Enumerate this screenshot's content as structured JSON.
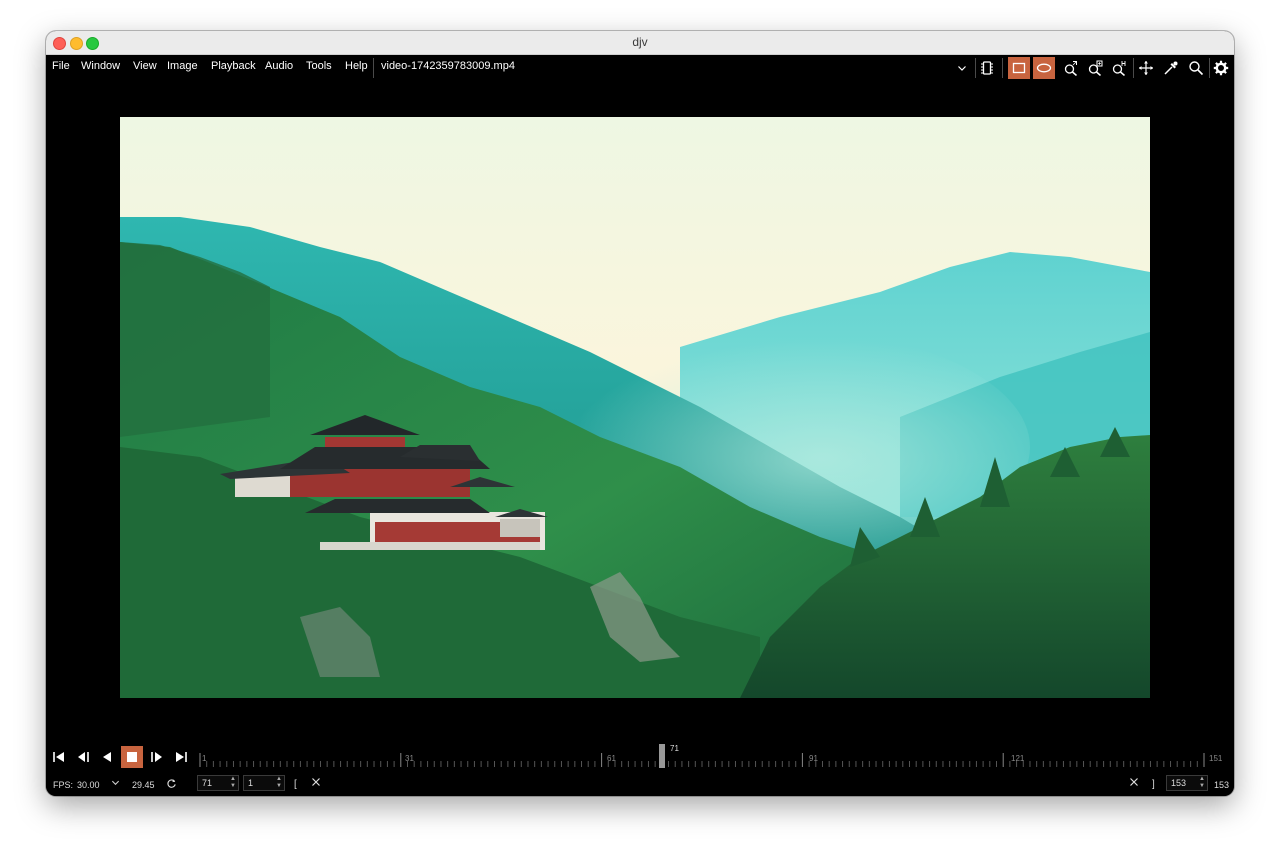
{
  "window": {
    "title": "djv"
  },
  "menu": [
    "File",
    "Window",
    "View",
    "Image",
    "Playback",
    "Audio",
    "Tools",
    "Help"
  ],
  "file": {
    "name": "video-1742359783009.mp4"
  },
  "toolbar": {
    "icons": [
      "dropdown-chevron-icon",
      "memory-chip-icon",
      "compare-rect-icon",
      "compare-ellipse-icon",
      "zoom-fit-icon",
      "zoom-in-icon",
      "zoom-reset-icon",
      "move-icon",
      "eyedropper-icon",
      "magnify-icon",
      "settings-gear-icon"
    ],
    "accent": "#c8643f"
  },
  "timeline": {
    "ticks": [
      "1",
      "31",
      "61",
      "91",
      "121",
      "151"
    ],
    "current": "71",
    "progress": 0.46
  },
  "status": {
    "fps_label": "FPS:",
    "fps_value": "30.00",
    "fps_actual": "29.45",
    "frame": "71",
    "step": "1",
    "in_bracket": "[",
    "out_bracket": "]",
    "end_frame": "153",
    "duration": "153"
  }
}
